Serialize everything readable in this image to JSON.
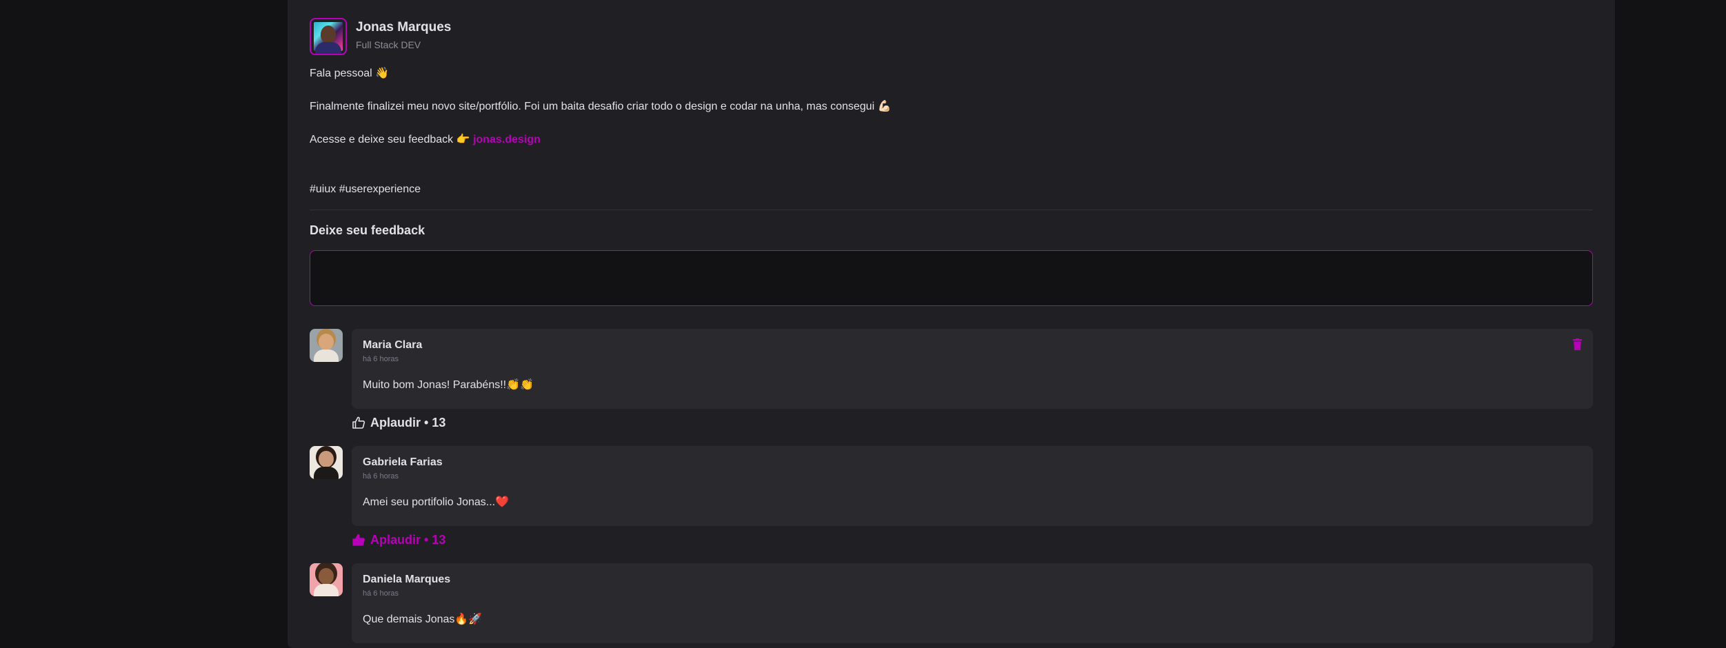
{
  "post": {
    "author": {
      "name": "Jonas Marques",
      "role": "Full Stack DEV"
    },
    "content": {
      "greeting": "Fala pessoal 👋",
      "paragraph": "Finalmente finalizei meu novo site/portfólio. Foi um baita desafio criar todo o design e codar na unha, mas consegui 💪🏻",
      "cta_prefix": "Acesse e deixe seu feedback 👉",
      "cta_link": "jonas.design",
      "tags": "#uiux #userexperience"
    }
  },
  "feedback_form": {
    "title": "Deixe seu feedback",
    "input_value": "",
    "placeholder": ""
  },
  "comments": [
    {
      "author": "Maria Clara",
      "time": "há 6 horas",
      "text": "Muito bom Jonas! Parabéns!!👏👏",
      "applaud_label": "Aplaudir • 13",
      "applauded": false,
      "show_delete": true
    },
    {
      "author": "Gabriela Farias",
      "time": "há 6 horas",
      "text": "Amei seu portifolio Jonas...❤️",
      "applaud_label": "Aplaudir • 13",
      "applauded": true,
      "show_delete": false
    },
    {
      "author": "Daniela Marques",
      "time": "há 6 horas",
      "text": "Que demais Jonas🔥🚀",
      "applaud_label": "",
      "applauded": false,
      "show_delete": false
    }
  ],
  "colors": {
    "accent": "#b900b9",
    "page_background": "#121214",
    "card_background": "#202024",
    "comment_background": "#29292e",
    "text": "#e1e1e6",
    "muted_text": "#8d8d99"
  },
  "icons": {
    "delete": "trash-icon",
    "applaud": "thumbs-up-icon"
  }
}
